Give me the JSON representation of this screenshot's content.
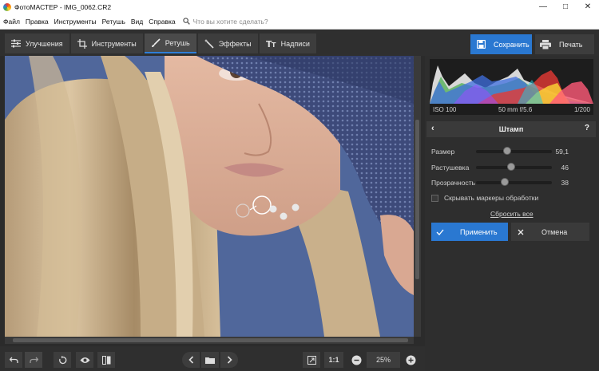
{
  "window": {
    "title": "ФотоМАСТЕР - IMG_0062.CR2"
  },
  "menu": {
    "items": [
      "Файл",
      "Правка",
      "Инструменты",
      "Ретушь",
      "Вид",
      "Справка"
    ],
    "search_placeholder": "Что вы хотите сделать?"
  },
  "tabs": [
    {
      "label": "Улучшения",
      "icon": "sliders-icon"
    },
    {
      "label": "Инструменты",
      "icon": "crop-icon"
    },
    {
      "label": "Ретушь",
      "icon": "brush-icon"
    },
    {
      "label": "Эффекты",
      "icon": "magic-wand-icon"
    },
    {
      "label": "Надписи",
      "icon": "text-icon"
    }
  ],
  "active_tab": "Ретушь",
  "actions": {
    "save_label": "Сохранить",
    "print_label": "Печать"
  },
  "histogram": {
    "iso": "ISO 100",
    "lens": "50 mm f/5.6",
    "shutter": "1/200"
  },
  "panel": {
    "title": "Штамп",
    "sliders": [
      {
        "label": "Размер",
        "value": "59,1",
        "fraction": 0.41
      },
      {
        "label": "Растушевка",
        "value": "46",
        "fraction": 0.46
      },
      {
        "label": "Прозрачность",
        "value": "38",
        "fraction": 0.38
      }
    ],
    "checkbox_label": "Скрывать маркеры обработки",
    "reset_label": "Сбросить все",
    "apply_label": "Применить",
    "cancel_label": "Отмена"
  },
  "bottom": {
    "ratio_label": "1:1",
    "zoom": "25%"
  },
  "colors": {
    "accent": "#2a78d1",
    "panel_bg": "#2e2e2e"
  }
}
